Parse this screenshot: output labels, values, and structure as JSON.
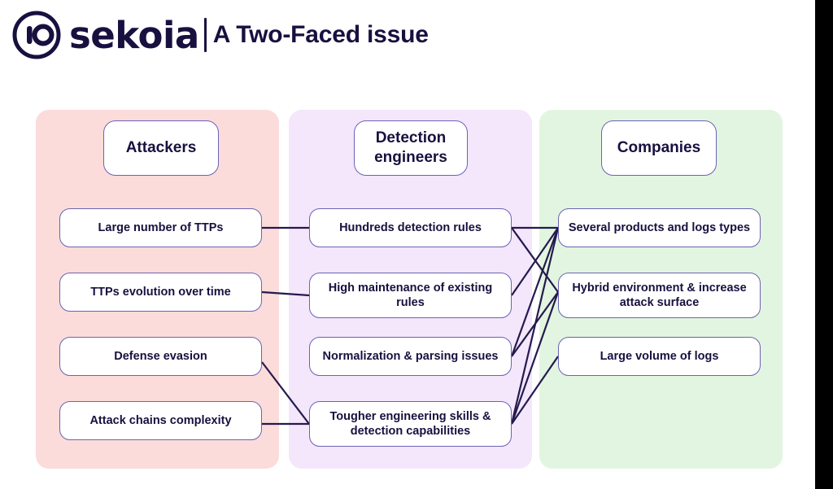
{
  "header": {
    "logo_icon": "sekoia-io-circle-logo",
    "wordmark": "sekoia",
    "title": "A Two-Faced issue"
  },
  "colors": {
    "brand_navy": "#18103f",
    "panel_attackers": "#fbdcda",
    "panel_detection": "#f4e6fb",
    "panel_companies": "#e2f5e0",
    "node_border": "#6b63b5",
    "connector": "#241a4d",
    "gutter": "#000000"
  },
  "diagram": {
    "columns": [
      {
        "id": "attackers",
        "heading": "Attackers",
        "items": [
          {
            "id": "a0",
            "label": "Large number of TTPs"
          },
          {
            "id": "a1",
            "label": "TTPs evolution over time"
          },
          {
            "id": "a2",
            "label": "Defense evasion"
          },
          {
            "id": "a3",
            "label": "Attack chains complexity"
          }
        ]
      },
      {
        "id": "detection",
        "heading": "Detection engineers",
        "items": [
          {
            "id": "d0",
            "label": "Hundreds detection rules"
          },
          {
            "id": "d1",
            "label": "High maintenance of existing rules"
          },
          {
            "id": "d2",
            "label": "Normalization & parsing issues"
          },
          {
            "id": "d3",
            "label": "Tougher engineering skills & detection capabilities"
          }
        ]
      },
      {
        "id": "companies",
        "heading": "Companies",
        "items": [
          {
            "id": "c0",
            "label": "Several products and logs types"
          },
          {
            "id": "c1",
            "label": "Hybrid environment & increase attack surface"
          },
          {
            "id": "c2",
            "label": "Large volume of logs"
          }
        ]
      }
    ],
    "connections": [
      {
        "from": "a0",
        "to": "d0"
      },
      {
        "from": "a1",
        "to": "d1"
      },
      {
        "from": "a2",
        "to": "d3"
      },
      {
        "from": "a3",
        "to": "d3"
      },
      {
        "from": "d0",
        "to": "c0"
      },
      {
        "from": "d0",
        "to": "c1"
      },
      {
        "from": "d1",
        "to": "c0"
      },
      {
        "from": "d2",
        "to": "c0"
      },
      {
        "from": "d2",
        "to": "c1"
      },
      {
        "from": "d3",
        "to": "c0"
      },
      {
        "from": "d3",
        "to": "c1"
      },
      {
        "from": "d3",
        "to": "c2"
      }
    ]
  }
}
